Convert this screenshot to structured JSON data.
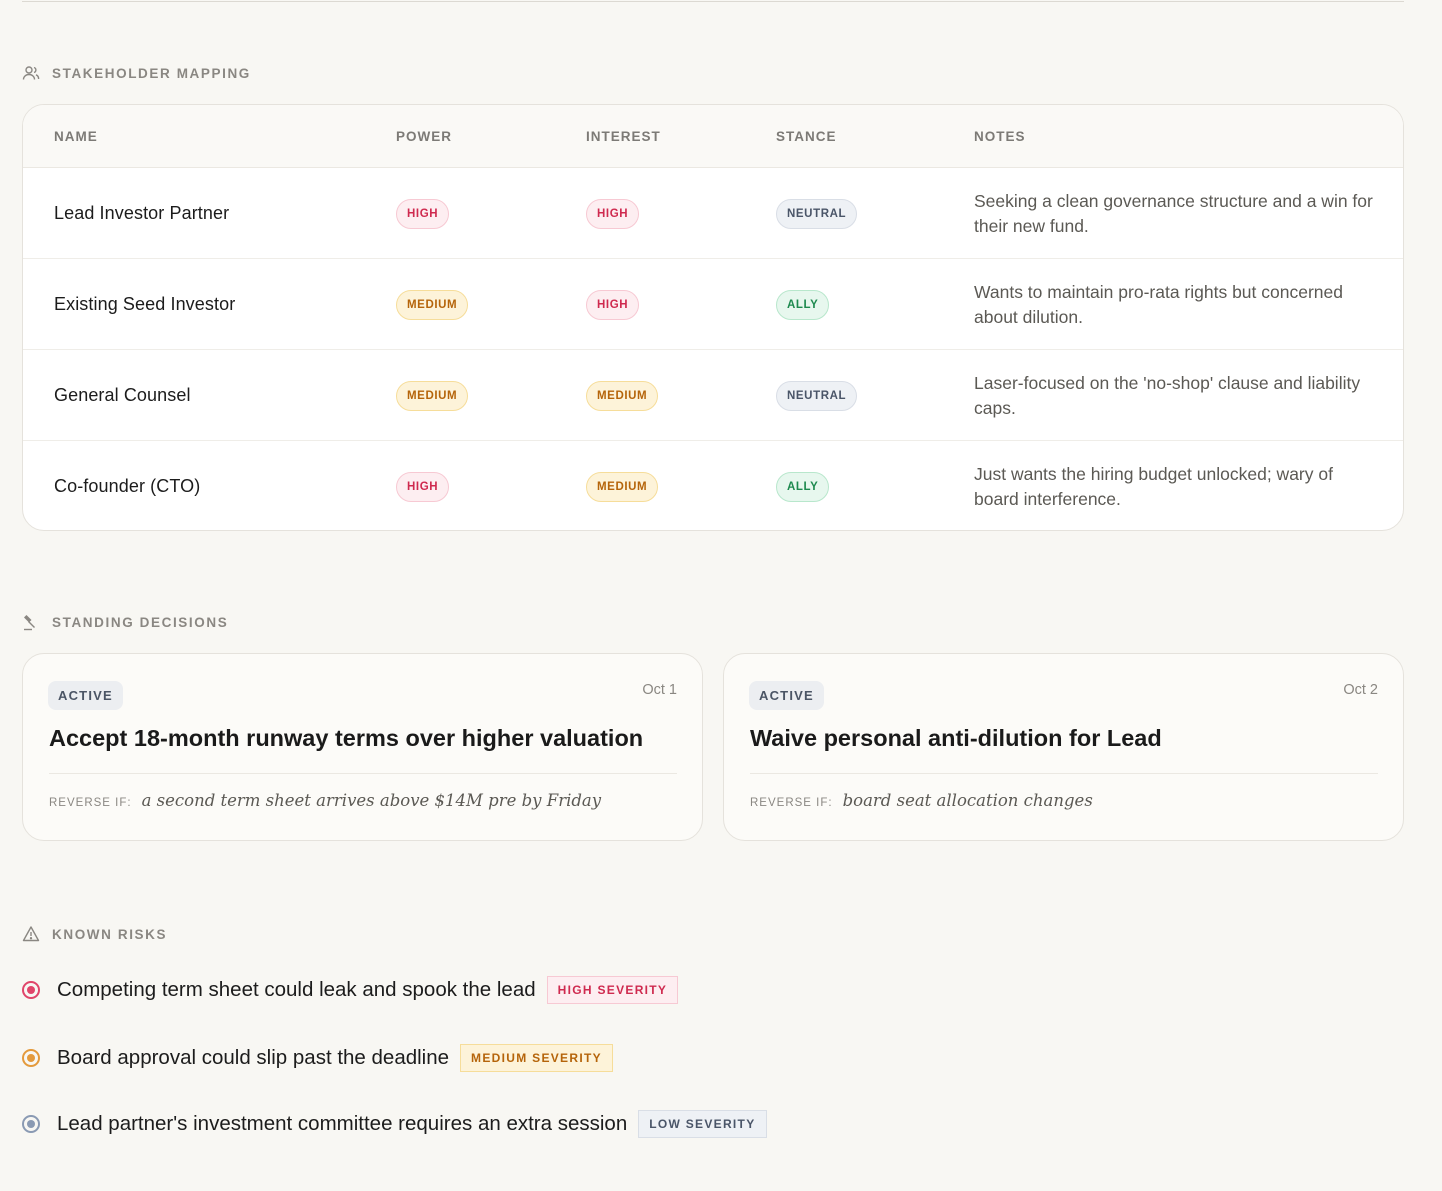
{
  "stakeholders": {
    "section_label": "STAKEHOLDER MAPPING",
    "columns": [
      "NAME",
      "POWER",
      "INTEREST",
      "STANCE",
      "NOTES"
    ],
    "rows": [
      {
        "name": "Lead Investor Partner",
        "power": "HIGH",
        "interest": "HIGH",
        "stance": "NEUTRAL",
        "notes": "Seeking a clean governance structure and a win for their new fund."
      },
      {
        "name": "Existing Seed Investor",
        "power": "MEDIUM",
        "interest": "HIGH",
        "stance": "ALLY",
        "notes": "Wants to maintain pro-rata rights but concerned about dilution."
      },
      {
        "name": "General Counsel",
        "power": "MEDIUM",
        "interest": "MEDIUM",
        "stance": "NEUTRAL",
        "notes": "Laser-focused on the 'no-shop' clause and liability caps."
      },
      {
        "name": "Co-founder (CTO)",
        "power": "HIGH",
        "interest": "MEDIUM",
        "stance": "ALLY",
        "notes": "Just wants the hiring budget unlocked; wary of board interference."
      }
    ]
  },
  "decisions": {
    "section_label": "STANDING DECISIONS",
    "reverse_label": "REVERSE IF:",
    "items": [
      {
        "status": "ACTIVE",
        "date": "Oct 1",
        "title": "Accept 18-month runway terms over higher valuation",
        "reverse_if": "a second term sheet arrives above $14M pre by Friday"
      },
      {
        "status": "ACTIVE",
        "date": "Oct 2",
        "title": "Waive personal anti-dilution for Lead",
        "reverse_if": "board seat allocation changes"
      }
    ]
  },
  "risks": {
    "section_label": "KNOWN RISKS",
    "items": [
      {
        "text": "Competing term sheet could leak and spook the lead",
        "severity": "HIGH SEVERITY",
        "level": "high",
        "color": "#e0456a"
      },
      {
        "text": "Board approval could slip past the deadline",
        "severity": "MEDIUM SEVERITY",
        "level": "medium",
        "color": "#e49a3c"
      },
      {
        "text": "Lead partner's investment committee requires an extra session",
        "severity": "LOW SEVERITY",
        "level": "low",
        "color": "#8a9ab3"
      }
    ]
  }
}
